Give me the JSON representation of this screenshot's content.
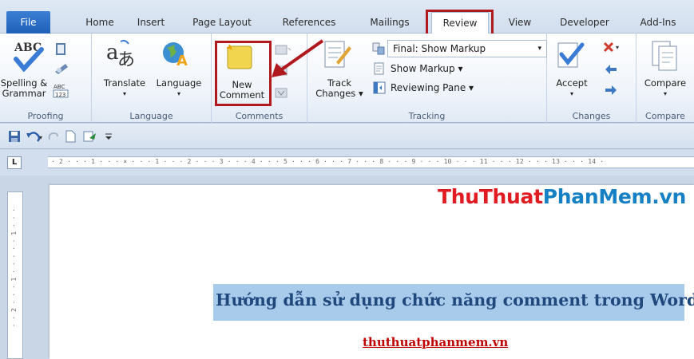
{
  "tabs": {
    "file": "File",
    "home": "Home",
    "insert": "Insert",
    "page_layout": "Page Layout",
    "references": "References",
    "mailings": "Mailings",
    "review": "Review",
    "view": "View",
    "developer": "Developer",
    "addins": "Add-Ins"
  },
  "ribbon": {
    "proofing": {
      "spelling_line1": "Spelling &",
      "spelling_line2": "Grammar",
      "label": "Proofing"
    },
    "language": {
      "translate": "Translate",
      "language": "Language",
      "label": "Language"
    },
    "comments": {
      "new_line1": "New",
      "new_line2": "Comment",
      "label": "Comments"
    },
    "tracking": {
      "track_line1": "Track",
      "track_line2": "Changes",
      "final_show_markup": "Final: Show Markup",
      "show_markup": "Show Markup",
      "reviewing_pane": "Reviewing Pane",
      "label": "Tracking"
    },
    "changes": {
      "accept": "Accept",
      "label": "Changes"
    },
    "compare": {
      "compare": "Compare",
      "label": "Compare"
    }
  },
  "ruler": {
    "text": "· 2 · · · 1 · · · ⨯ · · · 1 · · · 2 · · · 3 · · · 4 · · · 5 · · · 6 · · · 7 · · · 8 · · · 9 · · · 10 · · · 11 · · · 12 · · · 13 · · · 14 ·",
    "tab_selector": "L",
    "vertical_text": "· · 2 · · · 1 · · · · · 1 · · ·"
  },
  "document": {
    "watermark_part1": "ThuThuat",
    "watermark_part2": "PhanMem.vn",
    "title": "Hướng dẫn sử dụng chức năng comment trong Word",
    "link": "thuthuatphanmem.vn"
  },
  "colors": {
    "highlight": "#b0191e",
    "file_tab": "#2a6cc6",
    "watermark_red": "#e11b22",
    "watermark_blue": "#1581c4",
    "selection": "#a9cbeb"
  }
}
